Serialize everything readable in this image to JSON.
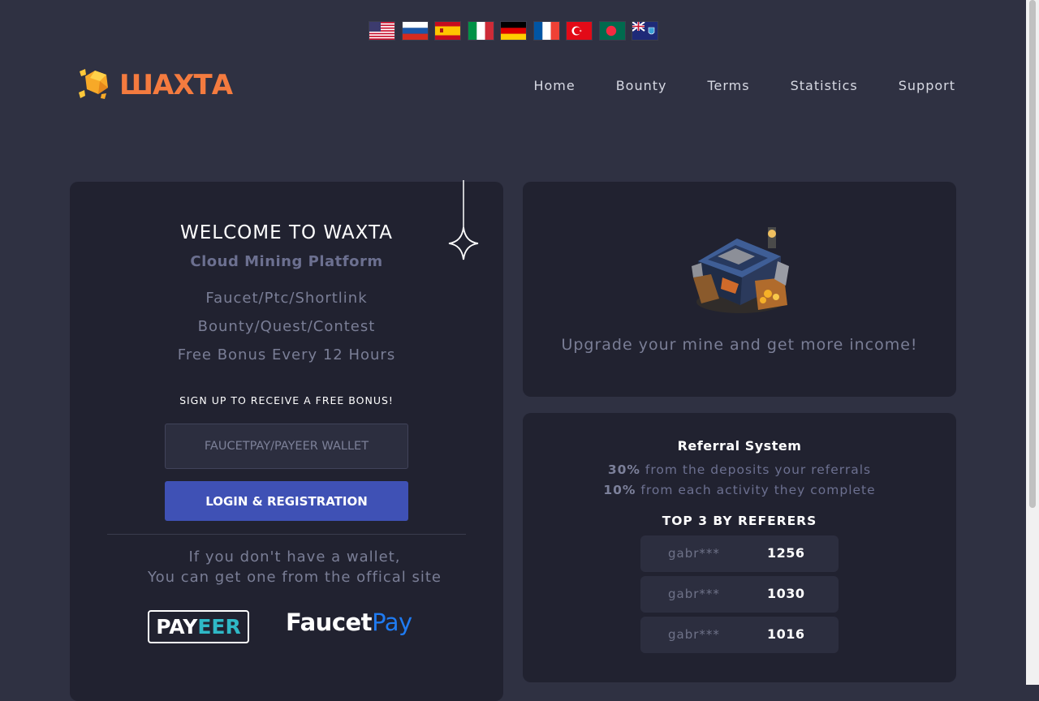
{
  "flags": [
    {
      "icon": "usa-flag-icon"
    },
    {
      "icon": "russia-flag-icon"
    },
    {
      "icon": "spain-flag-icon"
    },
    {
      "icon": "italy-flag-icon"
    },
    {
      "icon": "germany-flag-icon"
    },
    {
      "icon": "france-flag-icon"
    },
    {
      "icon": "turkey-flag-icon"
    },
    {
      "icon": "bangladesh-flag-icon"
    },
    {
      "icon": "montserrat-flag-icon"
    }
  ],
  "header": {
    "logo_text": "ШАХТА",
    "nav": [
      "Home",
      "Bounty",
      "Terms",
      "Statistics",
      "Support"
    ]
  },
  "welcome": {
    "title": "WELCOME TO WAXTA",
    "subtitle": "Cloud Mining Platform",
    "features": [
      "Faucet/Ptc/Shortlink",
      "Bounty/Quest/Contest",
      "Free Bonus Every 12 Hours"
    ],
    "signup_text": "SIGN UP TO RECEIVE A FREE BONUS!",
    "wallet_placeholder": "FAUCETPAY/PAYEER WALLET",
    "wallet_value": "",
    "login_label": "LOGIN & REGISTRATION",
    "no_wallet_line1": "If you don't have a wallet,",
    "no_wallet_line2": "You can get one from the offical site",
    "payeer": {
      "part1": "PAY",
      "part2": "EER"
    },
    "faucetpay": {
      "part1": "Faucet",
      "part2": "Pay"
    }
  },
  "mine": {
    "text": "Upgrade your mine and get more income!"
  },
  "referral": {
    "title": "Referral System",
    "line1_pct": "30%",
    "line1_text": " from the deposits your referrals",
    "line2_pct": "10%",
    "line2_text": " from each activity they complete",
    "top_title": "TOP 3 BY REFERERS",
    "top": [
      {
        "name": "gabr***",
        "count": "1256"
      },
      {
        "name": "gabr***",
        "count": "1030"
      },
      {
        "name": "gabr***",
        "count": "1016"
      }
    ]
  },
  "colors": {
    "background": "#2f3142",
    "panel": "#212230",
    "accent_button": "#3f51b5",
    "logo_orange": "#f47b3f",
    "payeer_cyan": "#2fb8c6",
    "faucetpay_blue": "#1f7bf2"
  }
}
